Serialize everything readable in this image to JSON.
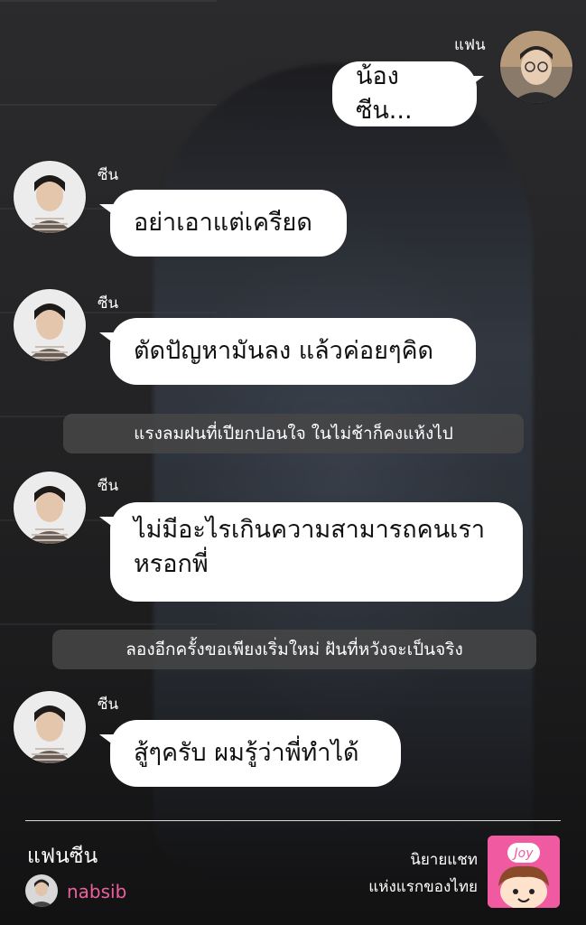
{
  "messages": [
    {
      "sender": "แฟน",
      "text": "น้องซีน..."
    },
    {
      "sender": "ซีน",
      "text": "อย่าเอาแต่เครียด"
    },
    {
      "sender": "ซีน",
      "text": "ตัดปัญหามันลง แล้วค่อยๆคิด"
    },
    {
      "narration": "แรงลมฝนที่เปียกปอนใจ ในไม่ช้าก็คงแห้งไป"
    },
    {
      "sender": "ซีน",
      "text_line1": "ไม่มีอะไรเกินความสามารถคนเรา",
      "text_line2": "หรอกพี่"
    },
    {
      "narration": "ลองอีกครั้งขอเพียงเริ่มใหม่ ฝันที่หวังจะเป็นจริง"
    },
    {
      "sender": "ซีน",
      "text": "สู้ๆครับ ผมรู้ว่าพี่ทำได้"
    }
  ],
  "footer": {
    "title": "แฟนซีน",
    "author": "nabsib",
    "promo_line1": "นิยายแชท",
    "promo_line2": "แห่งแรกของไทย",
    "logo_text": "Joy"
  },
  "colors": {
    "bubble": "#ffffff",
    "narration_bg": "#464648",
    "author": "#ef5fa0",
    "logo_bg": "#f05aa0"
  }
}
